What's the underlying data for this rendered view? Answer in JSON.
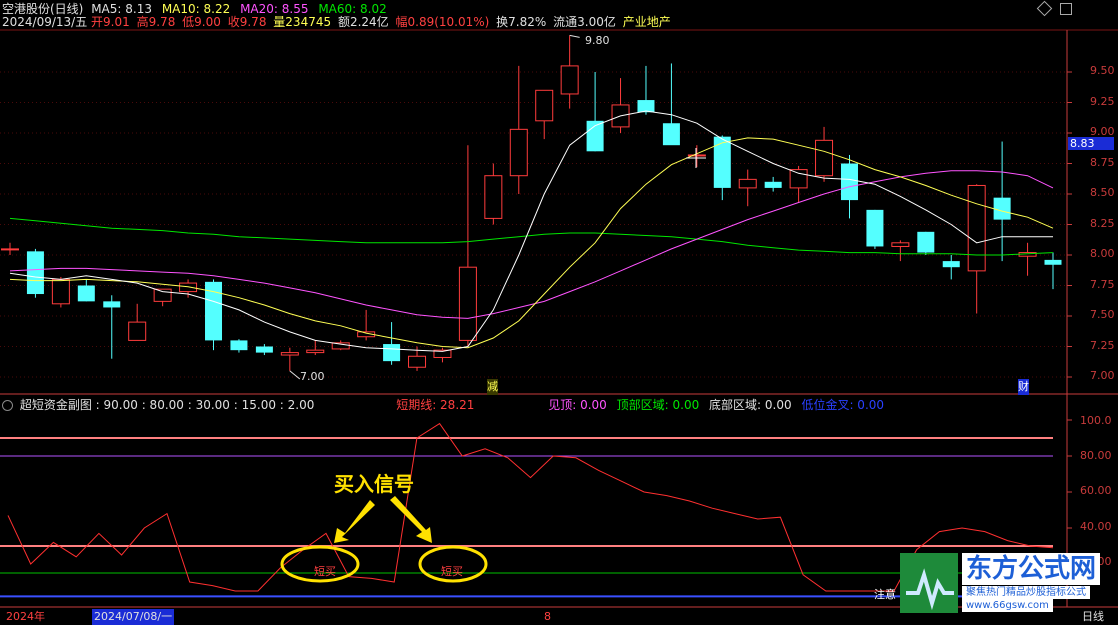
{
  "header": {
    "stock_name": "空港股份(日线)",
    "ma5": "MA5: 8.13",
    "ma10": "MA10: 8.22",
    "ma20": "MA20: 8.55",
    "ma60": "MA60: 8.02",
    "date": "2024/09/13/五",
    "open": "开9.01",
    "high": "高9.78",
    "low": "低9.00",
    "close": "收9.78",
    "volume": "量234745",
    "amount": "额2.24亿",
    "change": "幅0.89(10.01%)",
    "turnover": "换7.82%",
    "float_shares": "流通3.00亿",
    "sector": "产业地产"
  },
  "main_chart": {
    "y_ticks": [
      "9.50",
      "9.25",
      "9.00",
      "8.75",
      "8.50",
      "8.25",
      "8.00",
      "7.75",
      "7.50",
      "7.25",
      "7.00"
    ],
    "y_tick_values": [
      9.5,
      9.25,
      9.0,
      8.75,
      8.5,
      8.25,
      8.0,
      7.75,
      7.5,
      7.25,
      7.0
    ],
    "current_price": "8.83",
    "max_label": "9.80",
    "min_label": "7.00",
    "marker_reduce": "减",
    "marker_finance": "财"
  },
  "sub_chart": {
    "title": "超短资金副图",
    "params": ": 90.00 : 80.00 : 30.00 : 15.00 : 2.00",
    "short_line": "短期线: 28.21",
    "top_signal": "见顶: 0.00",
    "top_zone": "顶部区域: 0.00",
    "bottom_zone": "底部区域: 0.00",
    "low_golden": "低位金叉: 0.00",
    "y_ticks": [
      "100.0",
      "80.00",
      "60.00",
      "40.00",
      "20.00"
    ],
    "buy_label_1": "短买",
    "buy_label_2": "短买",
    "annotation": "买入信号",
    "attention": "注意",
    "buy_label_3": "短买"
  },
  "bottom_bar": {
    "year": "2024年",
    "date_range": "2024/07/08/一",
    "marker": "8",
    "period": "日线"
  },
  "watermark": {
    "brand": "东方公式网",
    "slogan": "聚焦热门精品炒股指标公式",
    "url": "www.66gsw.com"
  },
  "colors": {
    "up": "#ff3c3c",
    "down": "#54ffff",
    "ma5": "#ffffff",
    "ma10": "#ffff54",
    "ma20": "#ff54ff",
    "ma60": "#00e600",
    "axis": "#c83b3b"
  },
  "chart_data": {
    "type": "candlestick",
    "candles": [
      {
        "o": 8.05,
        "h": 8.1,
        "l": 8.0,
        "c": 8.05
      },
      {
        "o": 8.03,
        "h": 8.05,
        "l": 7.65,
        "c": 7.68
      },
      {
        "o": 7.6,
        "h": 7.82,
        "l": 7.57,
        "c": 7.8
      },
      {
        "o": 7.75,
        "h": 7.8,
        "l": 7.62,
        "c": 7.62
      },
      {
        "o": 7.62,
        "h": 7.67,
        "l": 7.15,
        "c": 7.57
      },
      {
        "o": 7.3,
        "h": 7.6,
        "l": 7.3,
        "c": 7.45
      },
      {
        "o": 7.62,
        "h": 7.72,
        "l": 7.58,
        "c": 7.72
      },
      {
        "o": 7.7,
        "h": 7.8,
        "l": 7.65,
        "c": 7.77
      },
      {
        "o": 7.78,
        "h": 7.8,
        "l": 7.22,
        "c": 7.3
      },
      {
        "o": 7.3,
        "h": 7.31,
        "l": 7.2,
        "c": 7.22
      },
      {
        "o": 7.25,
        "h": 7.27,
        "l": 7.18,
        "c": 7.2
      },
      {
        "o": 7.18,
        "h": 7.24,
        "l": 7.05,
        "c": 7.2
      },
      {
        "o": 7.2,
        "h": 7.3,
        "l": 7.18,
        "c": 7.22
      },
      {
        "o": 7.23,
        "h": 7.3,
        "l": 7.22,
        "c": 7.28
      },
      {
        "o": 7.33,
        "h": 7.55,
        "l": 7.3,
        "c": 7.37
      },
      {
        "o": 7.27,
        "h": 7.45,
        "l": 7.1,
        "c": 7.13
      },
      {
        "o": 7.08,
        "h": 7.25,
        "l": 7.05,
        "c": 7.17
      },
      {
        "o": 7.16,
        "h": 7.24,
        "l": 7.12,
        "c": 7.22
      },
      {
        "o": 7.3,
        "h": 8.9,
        "l": 7.25,
        "c": 7.9
      },
      {
        "o": 8.3,
        "h": 8.75,
        "l": 8.25,
        "c": 8.65
      },
      {
        "o": 8.65,
        "h": 9.55,
        "l": 8.5,
        "c": 9.03
      },
      {
        "o": 9.1,
        "h": 9.35,
        "l": 8.95,
        "c": 9.35
      },
      {
        "o": 9.32,
        "h": 9.8,
        "l": 9.2,
        "c": 9.55
      },
      {
        "o": 9.1,
        "h": 9.5,
        "l": 8.85,
        "c": 8.85
      },
      {
        "o": 9.05,
        "h": 9.45,
        "l": 9.0,
        "c": 9.23
      },
      {
        "o": 9.27,
        "h": 9.55,
        "l": 9.15,
        "c": 9.17
      },
      {
        "o": 9.08,
        "h": 9.57,
        "l": 8.95,
        "c": 8.9
      },
      {
        "o": 8.82,
        "h": 8.9,
        "l": 8.72,
        "c": 8.82
      },
      {
        "o": 8.97,
        "h": 8.98,
        "l": 8.45,
        "c": 8.55
      },
      {
        "o": 8.55,
        "h": 8.7,
        "l": 8.4,
        "c": 8.62
      },
      {
        "o": 8.6,
        "h": 8.64,
        "l": 8.52,
        "c": 8.55
      },
      {
        "o": 8.55,
        "h": 8.73,
        "l": 8.43,
        "c": 8.7
      },
      {
        "o": 8.65,
        "h": 9.05,
        "l": 8.6,
        "c": 8.94
      },
      {
        "o": 8.75,
        "h": 8.82,
        "l": 8.3,
        "c": 8.45
      },
      {
        "o": 8.37,
        "h": 8.37,
        "l": 8.05,
        "c": 8.07
      },
      {
        "o": 8.07,
        "h": 8.12,
        "l": 7.95,
        "c": 8.1
      },
      {
        "o": 8.19,
        "h": 8.19,
        "l": 8.0,
        "c": 8.02
      },
      {
        "o": 7.95,
        "h": 8.0,
        "l": 7.8,
        "c": 7.9
      },
      {
        "o": 7.87,
        "h": 8.58,
        "l": 7.52,
        "c": 8.57
      },
      {
        "o": 8.47,
        "h": 8.93,
        "l": 7.95,
        "c": 8.29
      },
      {
        "o": 7.99,
        "h": 8.1,
        "l": 7.83,
        "c": 8.02
      },
      {
        "o": 7.96,
        "h": 8.02,
        "l": 7.72,
        "c": 7.92
      }
    ],
    "ma5": [
      7.85,
      7.82,
      7.8,
      7.83,
      7.8,
      7.77,
      7.7,
      7.68,
      7.62,
      7.55,
      7.45,
      7.37,
      7.3,
      7.27,
      7.24,
      7.23,
      7.22,
      7.21,
      7.25,
      7.55,
      8.0,
      8.5,
      8.9,
      9.06,
      9.14,
      9.18,
      9.15,
      9.08,
      8.95,
      8.85,
      8.75,
      8.67,
      8.63,
      8.62,
      8.58,
      8.48,
      8.37,
      8.25,
      8.1,
      8.15,
      8.15,
      8.15
    ],
    "ma10": [
      7.8,
      7.79,
      7.79,
      7.8,
      7.79,
      7.78,
      7.76,
      7.74,
      7.7,
      7.65,
      7.59,
      7.52,
      7.46,
      7.42,
      7.36,
      7.32,
      7.28,
      7.25,
      7.24,
      7.32,
      7.46,
      7.68,
      7.9,
      8.1,
      8.38,
      8.58,
      8.74,
      8.83,
      8.92,
      8.96,
      8.95,
      8.9,
      8.85,
      8.78,
      8.7,
      8.64,
      8.57,
      8.49,
      8.42,
      8.36,
      8.31,
      8.22
    ],
    "ma20": [
      7.87,
      7.88,
      7.89,
      7.89,
      7.88,
      7.87,
      7.86,
      7.85,
      7.83,
      7.8,
      7.77,
      7.73,
      7.69,
      7.64,
      7.59,
      7.55,
      7.51,
      7.49,
      7.48,
      7.52,
      7.57,
      7.62,
      7.7,
      7.78,
      7.87,
      7.96,
      8.05,
      8.13,
      8.21,
      8.29,
      8.36,
      8.43,
      8.5,
      8.56,
      8.6,
      8.64,
      8.67,
      8.69,
      8.69,
      8.68,
      8.65,
      8.55
    ],
    "ma60": [
      8.3,
      8.28,
      8.26,
      8.24,
      8.22,
      8.21,
      8.2,
      8.18,
      8.17,
      8.15,
      8.14,
      8.13,
      8.12,
      8.11,
      8.1,
      8.1,
      8.1,
      8.1,
      8.11,
      8.13,
      8.15,
      8.17,
      8.18,
      8.18,
      8.17,
      8.16,
      8.15,
      8.13,
      8.11,
      8.08,
      8.06,
      8.04,
      8.03,
      8.02,
      8.02,
      8.01,
      8.01,
      8.01,
      8.0,
      8.0,
      8.01,
      8.02
    ],
    "short_line": [
      47,
      20,
      32,
      24,
      37,
      25,
      40,
      48,
      10,
      8,
      5,
      5,
      18,
      28,
      37,
      13,
      12,
      10,
      90,
      98,
      80,
      84,
      79,
      68,
      80,
      79,
      72,
      66,
      60,
      58,
      55,
      51,
      48,
      45,
      46,
      14,
      5,
      5,
      5,
      5,
      28,
      38,
      40,
      38,
      33,
      30,
      29
    ]
  }
}
